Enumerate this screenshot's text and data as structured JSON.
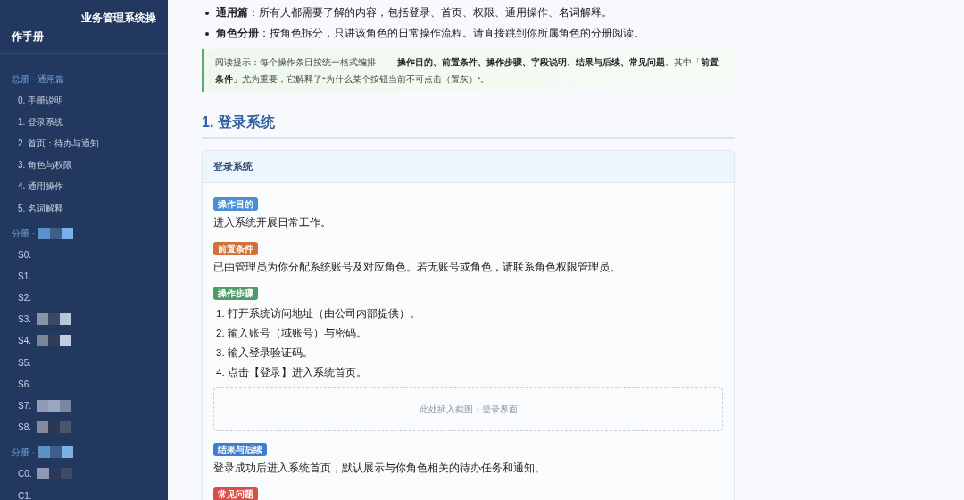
{
  "sidebar": {
    "title": "业务管理系统操作手册",
    "groups": [
      {
        "label": "总册 · 通用篇",
        "redacted": false,
        "items": [
          {
            "label": "0. 手册说明",
            "redacted": false
          },
          {
            "label": "1. 登录系统",
            "redacted": false
          },
          {
            "label": "2. 首页：待办与通知",
            "redacted": false
          },
          {
            "label": "3. 角色与权限",
            "redacted": false
          },
          {
            "label": "4. 通用操作",
            "redacted": false
          },
          {
            "label": "5. 名词解释",
            "redacted": false
          }
        ]
      },
      {
        "label": "分册 ·",
        "redacted": true,
        "items": [
          {
            "label": "S0.",
            "redacted": false
          },
          {
            "label": "S1.",
            "redacted": false
          },
          {
            "label": "S2.",
            "redacted": false
          },
          {
            "label": "S3.",
            "redacted": true
          },
          {
            "label": "S4.",
            "redacted": true
          },
          {
            "label": "S5.",
            "redacted": false
          },
          {
            "label": "S6.",
            "redacted": false
          },
          {
            "label": "S7.",
            "redacted": true
          },
          {
            "label": "S8.",
            "redacted": true
          }
        ]
      },
      {
        "label": "分册 ·",
        "redacted": true,
        "items": [
          {
            "label": "C0.",
            "redacted": true
          },
          {
            "label": "C1.",
            "redacted": false
          }
        ]
      }
    ]
  },
  "intro_bullets": [
    {
      "term": "通用篇",
      "text": "：所有人都需要了解的内容，包括登录、首页、权限、通用操作、名词解释。"
    },
    {
      "term": "角色分册",
      "text": "：按角色拆分，只讲该角色的日常操作流程。请直接跳到你所属角色的分册阅读。"
    }
  ],
  "tip": {
    "parts": [
      {
        "text": "阅读提示：每个操作条目按统一格式编排 —— ",
        "bold": false
      },
      {
        "text": "操作目的、前置条件、操作步骤、字段说明、结果与后续、常见问题",
        "bold": true
      },
      {
        "text": "。其中「",
        "bold": false
      },
      {
        "text": "前置条件",
        "bold": true
      },
      {
        "text": "」尤为重要，它解释了*为什么某个按钮当前不可点击（置灰）*。",
        "bold": false
      }
    ]
  },
  "section_heading": "1. 登录系统",
  "card": {
    "title": "登录系统",
    "blocks": [
      {
        "kind": "field",
        "label": "操作目的",
        "color": "#4a8fd6",
        "text": "进入系统开展日常工作。"
      },
      {
        "kind": "field",
        "label": "前置条件",
        "color": "#d0703a",
        "text": "已由管理员为你分配系统账号及对应角色。若无账号或角色，请联系角色权限管理员。"
      },
      {
        "kind": "steps",
        "label": "操作步骤",
        "color": "#4f9a66",
        "steps": [
          "1. 打开系统访问地址（由公司内部提供）。",
          "2. 输入账号（域账号）与密码。",
          "3. 输入登录验证码。",
          "4. 点击【登录】进入系统首页。"
        ]
      },
      {
        "kind": "placeholder",
        "text": "此处插入截图：登录界面"
      },
      {
        "kind": "field",
        "label": "结果与后续",
        "color": "#3f7fcf",
        "text": "登录成功后进入系统首页，默认展示与你角色相关的待办任务和通知。"
      },
      {
        "kind": "field",
        "label": "常见问题",
        "color": "#d64f48"
      }
    ]
  }
}
